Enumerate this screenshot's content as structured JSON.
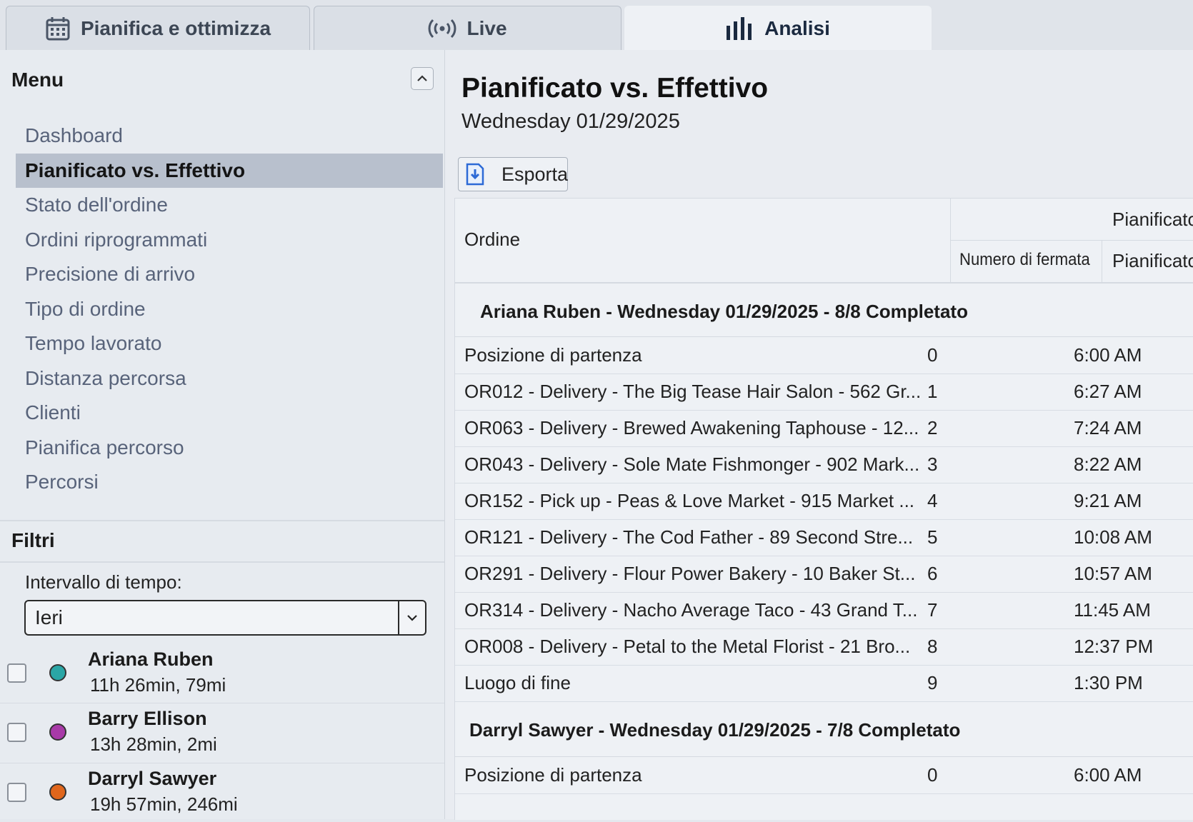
{
  "tabs": [
    {
      "label": "Pianifica e ottimizza",
      "icon": "calendar-icon",
      "active": false
    },
    {
      "label": "Live",
      "icon": "broadcast-icon",
      "active": false
    },
    {
      "label": "Analisi",
      "icon": "bar-chart-icon",
      "active": true
    }
  ],
  "sidebar": {
    "menu_title": "Menu",
    "items": [
      {
        "label": "Dashboard"
      },
      {
        "label": "Pianificato vs. Effettivo",
        "active": true
      },
      {
        "label": "Stato dell'ordine"
      },
      {
        "label": "Ordini riprogrammati"
      },
      {
        "label": "Precisione di arrivo"
      },
      {
        "label": "Tipo di ordine"
      },
      {
        "label": "Tempo lavorato"
      },
      {
        "label": "Distanza percorsa"
      },
      {
        "label": "Clienti"
      },
      {
        "label": "Pianifica percorso"
      },
      {
        "label": "Percorsi"
      }
    ],
    "filters_title": "Filtri",
    "interval_label": "Intervallo di tempo:",
    "interval_value": "Ieri",
    "drivers": [
      {
        "name": "Ariana Ruben",
        "stats": "11h 26min, 79mi",
        "color": "#2aa6a6"
      },
      {
        "name": "Barry Ellison",
        "stats": "13h 28min, 2mi",
        "color": "#a83aa8"
      },
      {
        "name": "Darryl Sawyer",
        "stats": "19h 57min, 246mi",
        "color": "#e0661c"
      }
    ]
  },
  "main": {
    "title": "Pianificato vs. Effettivo",
    "date": "Wednesday 01/29/2025",
    "export_label": "Esporta",
    "table": {
      "col_order": "Ordine",
      "col_group_planned": "Pianificato",
      "col_stop_number": "Numero di fermata",
      "col_planned_time": "Pianificato",
      "groups": [
        {
          "label": "Ariana Ruben - Wednesday 01/29/2025 - 8/8 Completato",
          "rows": [
            {
              "order": "Posizione di partenza",
              "stop": "0",
              "time": "6:00 AM"
            },
            {
              "order": "OR012 - Delivery - The Big Tease Hair Salon - 562 Gr...",
              "stop": "1",
              "time": "6:27 AM"
            },
            {
              "order": "OR063 - Delivery - Brewed Awakening Taphouse - 12...",
              "stop": "2",
              "time": "7:24 AM"
            },
            {
              "order": "OR043 - Delivery - Sole Mate Fishmonger - 902 Mark...",
              "stop": "3",
              "time": "8:22 AM"
            },
            {
              "order": "OR152 - Pick up - Peas & Love Market - 915 Market ...",
              "stop": "4",
              "time": "9:21 AM"
            },
            {
              "order": "OR121 - Delivery - The Cod Father - 89 Second Stre...",
              "stop": "5",
              "time": "10:08 AM"
            },
            {
              "order": "OR291 - Delivery - Flour Power Bakery - 10 Baker St...",
              "stop": "6",
              "time": "10:57 AM"
            },
            {
              "order": "OR314 - Delivery - Nacho Average Taco - 43 Grand T...",
              "stop": "7",
              "time": "11:45 AM"
            },
            {
              "order": "OR008 - Delivery - Petal to the Metal Florist - 21 Bro...",
              "stop": "8",
              "time": "12:37 PM"
            },
            {
              "order": "Luogo di fine",
              "stop": "9",
              "time": "1:30 PM"
            }
          ]
        },
        {
          "label": "Darryl Sawyer - Wednesday 01/29/2025 - 7/8 Completato",
          "rows": [
            {
              "order": "Posizione di partenza",
              "stop": "0",
              "time": "6:00 AM"
            }
          ]
        }
      ]
    }
  }
}
